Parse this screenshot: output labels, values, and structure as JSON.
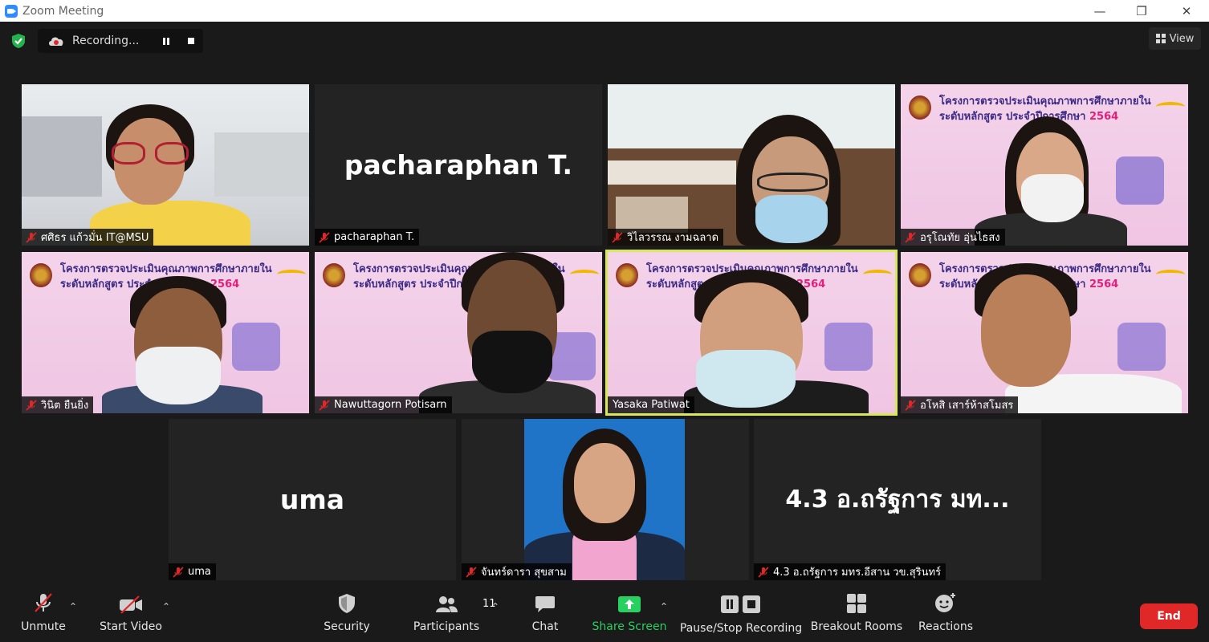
{
  "window": {
    "title": "Zoom Meeting"
  },
  "recording": {
    "label": "Recording..."
  },
  "view_button": {
    "label": "View"
  },
  "tiles": [
    {
      "name": "ศศิธร แก้วมั่น IT@MSU",
      "big": ""
    },
    {
      "name": "pacharaphan T.",
      "big": "pacharaphan T."
    },
    {
      "name": "วิไลวรรณ งามฉลาด",
      "big": ""
    },
    {
      "name": "อรุโณทัย อุ่นไธสง",
      "big": ""
    },
    {
      "name": "วินิต ยืนยิ่ง",
      "big": ""
    },
    {
      "name": "Nawuttagorn Potisarn",
      "big": ""
    },
    {
      "name": "Yasaka Patiwat",
      "big": ""
    },
    {
      "name": "อโหสิ เสาร์ห้าสโมสร",
      "big": ""
    },
    {
      "name": "uma",
      "big": "uma"
    },
    {
      "name": "จันทร์ดารา สุขสาม",
      "big": ""
    },
    {
      "name": "4.3 อ.ถรัฐการ มทร.อีสาน วข.สุรินทร์",
      "big": "4.3 อ.ถรัฐการ มท..."
    }
  ],
  "banner": {
    "line1": "โครงการตรวจประเมินคุณภาพการศึกษาภายใน",
    "line2": "ระดับหลักสูตร ประจำปีการศึกษา",
    "year": "2564"
  },
  "toolbar": {
    "unmute": "Unmute",
    "start_video": "Start Video",
    "security": "Security",
    "participants": "Participants",
    "participants_count": "11",
    "chat": "Chat",
    "share_screen": "Share Screen",
    "pause_stop_recording": "Pause/Stop Recording",
    "breakout_rooms": "Breakout Rooms",
    "reactions": "Reactions",
    "end": "End"
  },
  "colors": {
    "accent_green": "#26d15f",
    "end_red": "#e02828",
    "active_speaker": "#d8e85a",
    "brand_blue": "#2d8cff"
  }
}
